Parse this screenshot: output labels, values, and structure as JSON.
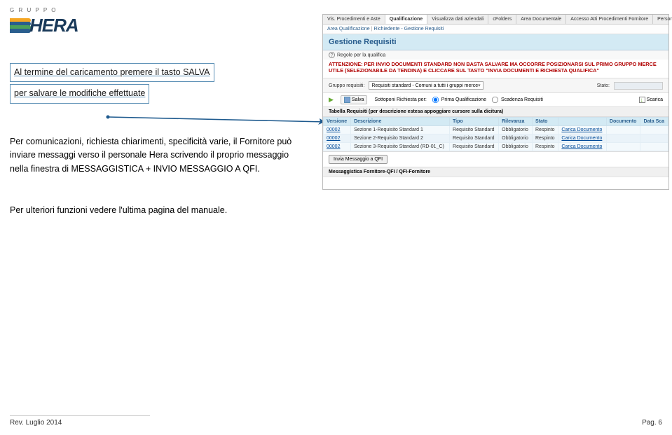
{
  "logo": {
    "group": "G R U P P O",
    "brand": "HERA"
  },
  "left": {
    "boxed1": "Al termine del caricamento premere il tasto SALVA",
    "boxed2": "per salvare le modifiche effettuate",
    "para": "Per comunicazioni, richiesta chiarimenti, specificità varie, il Fornitore può inviare messaggi verso il personale Hera scrivendo il proprio messaggio nella finestra di MESSAGGISTICA + INVIO MESSAGGIO A QFI.",
    "footer": "Per ulteriori funzioni vedere l'ultima pagina del manuale."
  },
  "screenshot": {
    "tabs": [
      "Vis. Procedimenti e Aste",
      "Qualificazione",
      "Visualizza dati aziendali",
      "cFolders",
      "Area Documentale",
      "Accesso Atti Procedimenti Fornitore",
      "Personalizzazione Portale"
    ],
    "active_tab_index": 1,
    "breadcrumb": {
      "a": "Area Qualificazione",
      "sep": "|",
      "b": "Richiedente - Gestione Requisiti"
    },
    "section_title": "Gestione Requisiti",
    "regole_label": "Regole per la qualifica",
    "attenzione": "ATTENZIONE: PER INVIO DOCUMENTI STANDARD NON BASTA SALVARE MA OCCORRE POSIZIONARSI SUL PRIMO GRUPPO MERCE UTILE (SELEZIONABILE DA TENDINA) E CLICCARE SUL TASTO \"INVIA DOCUMENTI E RICHIESTA QUALIFICA\"",
    "filters": {
      "gruppo_label": "Gruppo requisiti:",
      "gruppo_value": "Requisiti standard - Comuni a tutti i gruppi merce",
      "stato_label": "Stato:"
    },
    "toolbar": {
      "salva": "Salva",
      "sottoponi": "Sottoponi Richiesta per:",
      "radio1": "Prima Qualificazione",
      "radio2": "Scadenza Requisiti",
      "scarica": "Scarica"
    },
    "table": {
      "caption": "Tabella Requisiti (per descrizione estesa appoggiare cursore sulla dicitura)",
      "headers": [
        "Versione",
        "Descrizione",
        "Tipo",
        "Rilevanza",
        "Stato",
        "",
        "Documento",
        "Data Sca"
      ],
      "rows": [
        {
          "ver": "00002",
          "desc": "Sezione 1-Requisito Standard 1",
          "tipo": "Requisito Standard",
          "ril": "Obbligatorio",
          "stato": "Respinto",
          "link": "Carica Documento"
        },
        {
          "ver": "00002",
          "desc": "Sezione 2-Requisito Standard 2",
          "tipo": "Requisito Standard",
          "ril": "Obbligatorio",
          "stato": "Respinto",
          "link": "Carica Documento"
        },
        {
          "ver": "00002",
          "desc": "Sezione 3-Requisito Standard (RD-01_C)",
          "tipo": "Requisito Standard",
          "ril": "Obbligatorio",
          "stato": "Respinto",
          "link": "Carica Documento"
        }
      ]
    },
    "invia_btn": "Invia Messaggio a QFI",
    "msg_caption": "Messaggistica Fornitore-QFI / QFI-Fornitore"
  },
  "page_footer": {
    "left": "Rev. Luglio 2014",
    "right": "Pag. 6"
  }
}
